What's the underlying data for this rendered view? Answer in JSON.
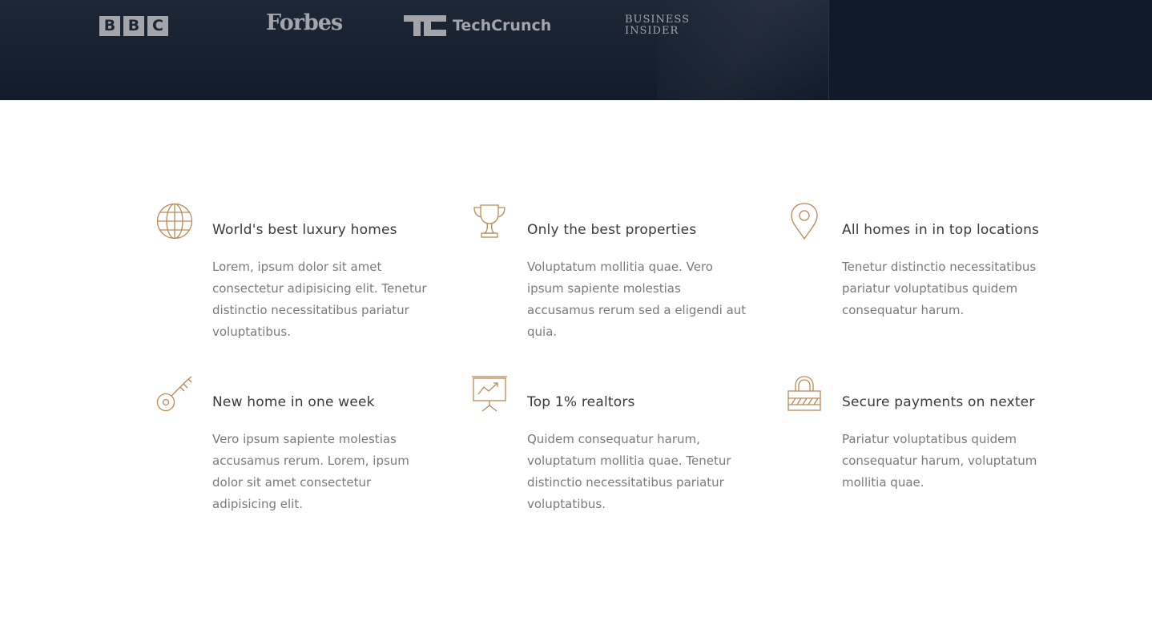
{
  "featured": {
    "logos": {
      "bbc": [
        "B",
        "B",
        "C"
      ],
      "forbes": "Forbes",
      "techcrunch": "TechCrunch",
      "business_insider_line1": "Business",
      "business_insider_line2": "Insider"
    }
  },
  "colors": {
    "accent": "#b88a57",
    "dark_bar": "#172030",
    "heading": "#3a3a3a",
    "body_text": "#7a7a7a"
  },
  "features": [
    {
      "icon": "globe-icon",
      "title": "World's best luxury homes",
      "text": "Lorem, ipsum dolor sit amet consectetur adipisicing elit. Tenetur distinctio necessitatibus pariatur voluptatibus."
    },
    {
      "icon": "trophy-icon",
      "title": "Only the best properties",
      "text": "Voluptatum mollitia quae. Vero ipsum sapiente molestias accusamus rerum sed a eligendi aut quia."
    },
    {
      "icon": "map-pin-icon",
      "title": "All homes in in top locations",
      "text": "Tenetur distinctio necessitatibus pariatur voluptatibus quidem consequatur harum."
    },
    {
      "icon": "key-icon",
      "title": "New home in one week",
      "text": "Vero ipsum sapiente molestias accusamus rerum. Lorem, ipsum dolor sit amet consectetur adipisicing elit."
    },
    {
      "icon": "presentation-chart-icon",
      "title": "Top 1% realtors",
      "text": "Quidem consequatur harum, voluptatum mollitia quae. Tenetur distinctio necessitatibus pariatur voluptatibus."
    },
    {
      "icon": "lock-icon",
      "title": "Secure payments on nexter",
      "text": "Pariatur voluptatibus quidem consequatur harum, voluptatum mollitia quae."
    }
  ]
}
